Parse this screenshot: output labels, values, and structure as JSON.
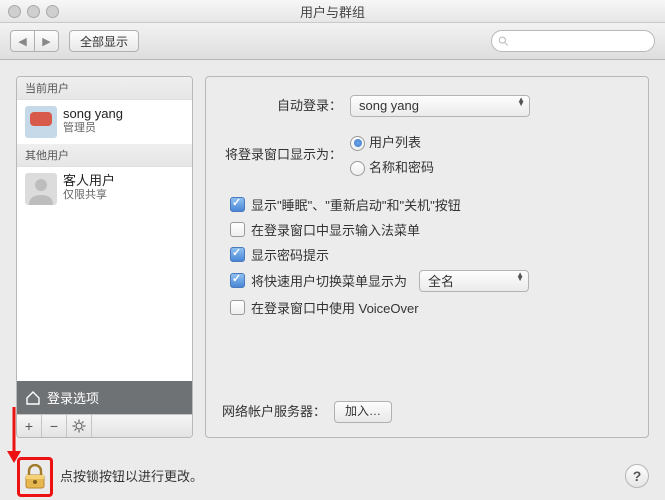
{
  "window": {
    "title": "用户与群组"
  },
  "toolbar": {
    "show_all": "全部显示",
    "search_placeholder": ""
  },
  "sidebar": {
    "current_header": "当前用户",
    "other_header": "其他用户",
    "current": {
      "name": "song yang",
      "role": "管理员"
    },
    "guest": {
      "name": "客人用户",
      "role": "仅限共享"
    },
    "login_options": "登录选项",
    "add": "+",
    "remove": "−",
    "gear": "✻"
  },
  "main": {
    "auto_login_label": "自动登录：",
    "auto_login_value": "song yang",
    "display_as_label": "将登录窗口显示为：",
    "radio_user_list": "用户列表",
    "radio_name_pwd": "名称和密码",
    "chk_sleep": "显示\"睡眠\"、\"重新启动\"和\"关机\"按钮",
    "chk_input": "在登录窗口中显示输入法菜单",
    "chk_pwhint": "显示密码提示",
    "chk_fastswitch": "将快速用户切换菜单显示为",
    "fastswitch_value": "全名",
    "chk_voiceover": "在登录窗口中使用 VoiceOver",
    "network_label": "网络帐户服务器：",
    "join_btn": "加入…"
  },
  "footer": {
    "lock_hint": "点按锁按钮以进行更改。",
    "help": "?"
  }
}
